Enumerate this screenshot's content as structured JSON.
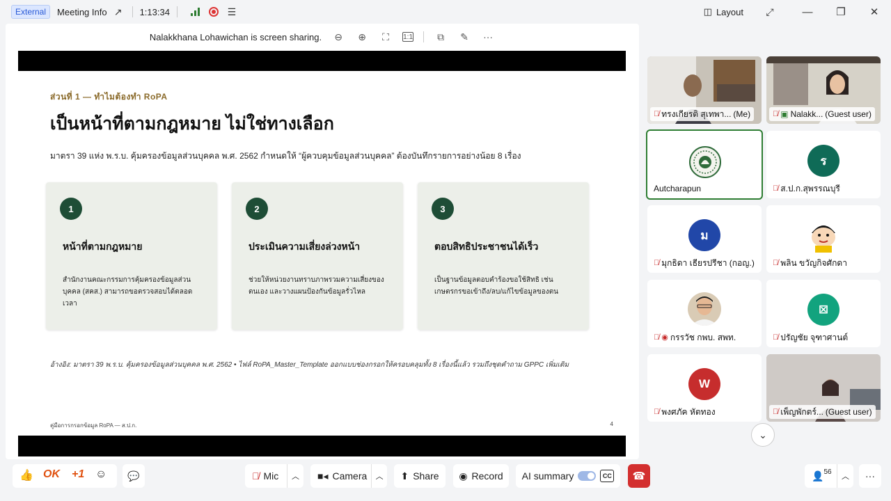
{
  "titlebar": {
    "external_badge": "External",
    "meeting_info": "Meeting Info",
    "elapsed": "1:13:34",
    "layout_label": "Layout"
  },
  "share_bar": {
    "sharing_text": "Nalakkhana Lohawichan is screen sharing."
  },
  "slide": {
    "section_label": "ส่วนที่ 1 — ทำไมต้องทำ RoPA",
    "title": "เป็นหน้าที่ตามกฎหมาย ไม่ใช่ทางเลือก",
    "subtitle": "มาตรา 39 แห่ง พ.ร.บ. คุ้มครองข้อมูลส่วนบุคคล พ.ศ. 2562 กำหนดให้ “ผู้ควบคุมข้อมูลส่วนบุคคล” ต้องบันทึกรายการอย่างน้อย 8 เรื่อง",
    "cards": [
      {
        "num": "1",
        "title": "หน้าที่ตามกฎหมาย",
        "desc": "สำนักงานคณะกรรมการคุ้มครองข้อมูลส่วนบุคคล (สคส.) สามารถขอตรวจสอบได้ตลอดเวลา"
      },
      {
        "num": "2",
        "title": "ประเมินความเสี่ยงล่วงหน้า",
        "desc": "ช่วยให้หน่วยงานทราบภาพรวมความเสี่ยงของตนเอง และวางแผนป้องกันข้อมูลรั่วไหล"
      },
      {
        "num": "3",
        "title": "ตอบสิทธิประชาชนได้เร็ว",
        "desc": "เป็นฐานข้อมูลตอบคำร้องขอใช้สิทธิ เช่น เกษตรกรขอเข้าถึง/ลบ/แก้ไขข้อมูลของตน"
      }
    ],
    "reference": "อ้างอิง: มาตรา 39 พ.ร.บ. คุ้มครองข้อมูลส่วนบุคคล พ.ศ. 2562 • ไฟล์ RoPA_Master_Template ออกแบบช่องกรอกให้ครอบคลุมทั้ง 8 เรื่องนี้แล้ว รวมถึงชุดคำถาม GPPC เพิ่มเติม",
    "footer_left": "คู่มือการกรอกข้อมูล RoPA — ส.ป.ก.",
    "page_number": "4"
  },
  "participants": [
    {
      "name": "ทรงเกียรติ สุเทพา...",
      "suffix": "(Me)",
      "kind": "video"
    },
    {
      "name": "Nalakk...",
      "suffix": "(Guest user)",
      "kind": "video"
    },
    {
      "name": "Autcharapun",
      "suffix": "",
      "kind": "logo"
    },
    {
      "name": "ส.ป.ก.สุพรรณบุรี",
      "suffix": "",
      "kind": "avatar",
      "initial": "ร",
      "color": "#0f6b57"
    },
    {
      "name": "มุกธิดา เธียรปรีชา (กอญ.)",
      "suffix": "",
      "kind": "avatar",
      "initial": "ม",
      "color": "#2147a8"
    },
    {
      "name": "พลิน ขวัญกิจศักดา",
      "suffix": "",
      "kind": "cartoon"
    },
    {
      "name": "กรรวัช กพบ. สพท.",
      "suffix": "",
      "kind": "photo"
    },
    {
      "name": "ปรัญชัย จุฑาศานต์",
      "suffix": "",
      "kind": "avatar",
      "initial": "⊠",
      "color": "#12a37e"
    },
    {
      "name": "พงศภัค หัตทอง",
      "suffix": "",
      "kind": "avatar",
      "initial": "W",
      "color": "#c62d2d"
    },
    {
      "name": "เพ็ญพักตร์...",
      "suffix": "(Guest user)",
      "kind": "video"
    }
  ],
  "toolbar": {
    "ok_label": "OK",
    "plus_one_label": "+1",
    "mic_label": "Mic",
    "camera_label": "Camera",
    "share_label": "Share",
    "record_label": "Record",
    "ai_summary_label": "AI summary",
    "cc_label": "CC",
    "participants_count": "56"
  }
}
